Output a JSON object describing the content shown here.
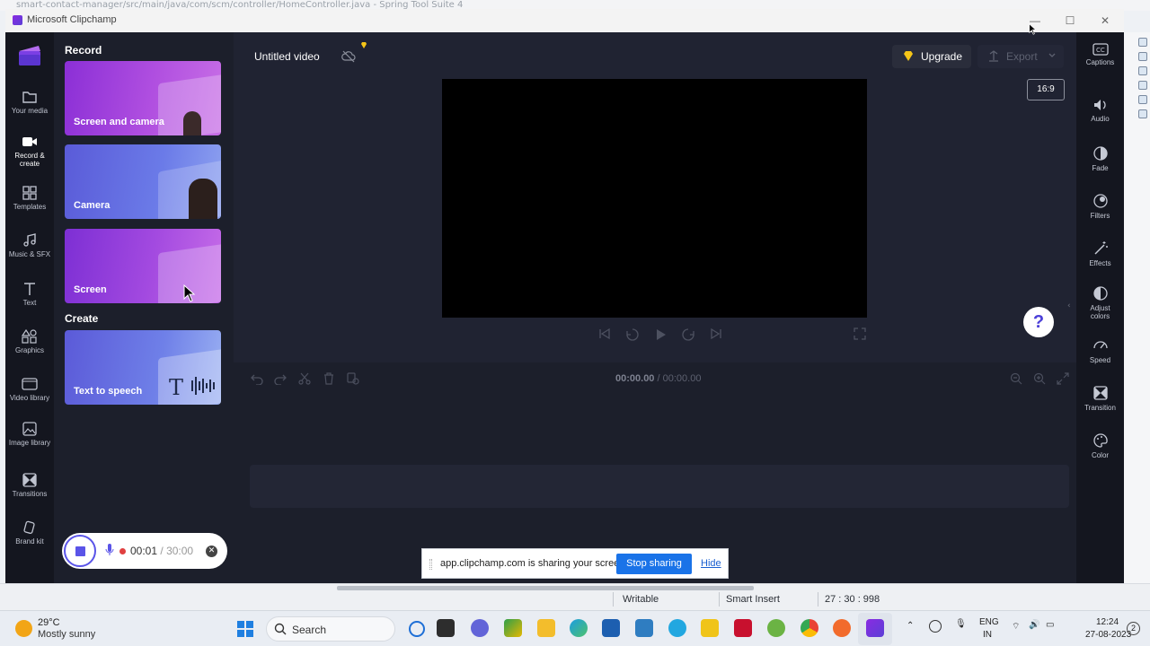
{
  "background_ide": {
    "top_path": "smart-contact-manager/src/main/java/com/scm/controller/HomeController.java - Spring Tool Suite 4",
    "status": {
      "writable": "Writable",
      "insert_mode": "Smart Insert",
      "position": "27 : 30 : 998"
    }
  },
  "window": {
    "title": "Microsoft Clipchamp",
    "minimize": "—",
    "maximize": "☐",
    "close": "✕"
  },
  "left_nav": {
    "items": [
      {
        "label": "Your media",
        "icon": "folder-icon"
      },
      {
        "label": "Record & create",
        "icon": "video-camera-icon"
      },
      {
        "label": "Templates",
        "icon": "templates-icon"
      },
      {
        "label": "Music & SFX",
        "icon": "music-note-icon"
      },
      {
        "label": "Text",
        "icon": "text-icon"
      },
      {
        "label": "Graphics",
        "icon": "shapes-icon"
      },
      {
        "label": "Video library",
        "icon": "video-library-icon"
      },
      {
        "label": "Image library",
        "icon": "image-icon"
      },
      {
        "label": "Transitions",
        "icon": "transitions-icon"
      },
      {
        "label": "Brand kit",
        "icon": "brand-kit-icon"
      }
    ]
  },
  "panel": {
    "record_title": "Record",
    "create_title": "Create",
    "cards": [
      {
        "label": "Screen and camera"
      },
      {
        "label": "Camera"
      },
      {
        "label": "Screen"
      },
      {
        "label": "Text to speech"
      }
    ]
  },
  "recording": {
    "elapsed": "00:01",
    "separator": "/",
    "max": "30:00"
  },
  "editor": {
    "video_title": "Untitled video",
    "upgrade_label": "Upgrade",
    "export_label": "Export",
    "aspect_ratio": "16:9",
    "help_label": "?",
    "timecode_current": "00:00.00",
    "timecode_separator": "/",
    "timecode_total": "00:00.00"
  },
  "right_bar": {
    "items": [
      {
        "label": "Captions",
        "icon": "captions-icon"
      },
      {
        "label": "Audio",
        "icon": "speaker-icon"
      },
      {
        "label": "Fade",
        "icon": "fade-icon"
      },
      {
        "label": "Filters",
        "icon": "filters-icon"
      },
      {
        "label": "Effects",
        "icon": "magic-wand-icon"
      },
      {
        "label": "Adjust colors",
        "icon": "contrast-icon"
      },
      {
        "label": "Speed",
        "icon": "speedometer-icon"
      },
      {
        "label": "Transition",
        "icon": "transition-icon"
      },
      {
        "label": "Color",
        "icon": "palette-icon"
      }
    ]
  },
  "sharing_bar": {
    "message": "app.clipchamp.com is sharing your screen.",
    "stop_label": "Stop sharing",
    "hide_label": "Hide"
  },
  "taskbar": {
    "weather_temp": "29°C",
    "weather_desc": "Mostly sunny",
    "search_label": "Search",
    "lang_top": "ENG",
    "lang_bottom": "IN",
    "time": "12:24",
    "date": "27-08-2023",
    "notifications": "2"
  },
  "colors": {
    "accent": "#5a54e8",
    "share_blue": "#1a73e8",
    "bg_dark": "#1c1f2b"
  }
}
